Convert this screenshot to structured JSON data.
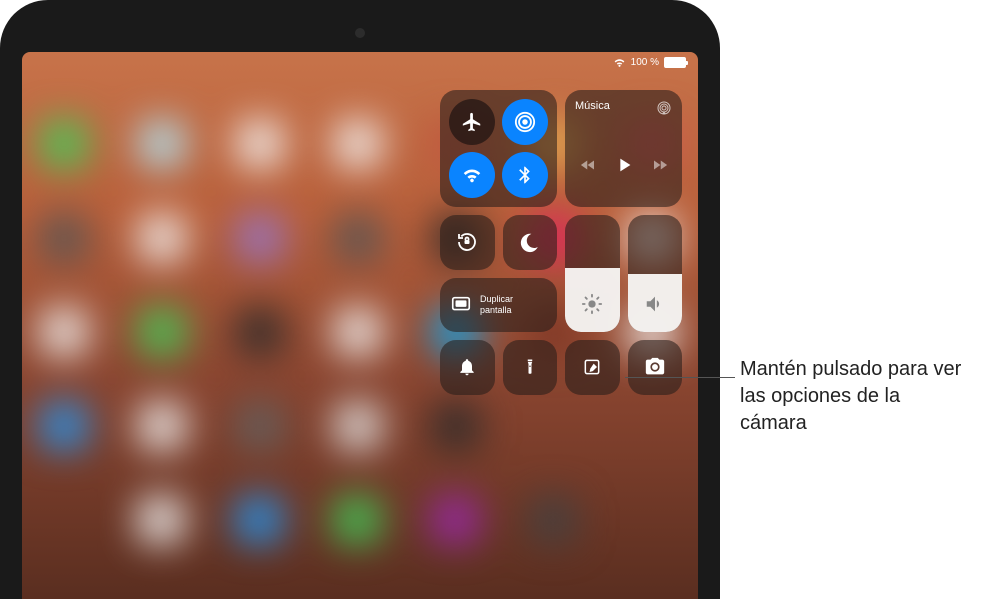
{
  "status_bar": {
    "battery_text": "100 %"
  },
  "control_center": {
    "media": {
      "title": "Música"
    },
    "screen_mirror": {
      "label": "Duplicar\npantalla"
    }
  },
  "callout": {
    "text": "Mantén pulsado para ver las opciones de la cámara"
  },
  "brightness_level": 55,
  "volume_level": 50
}
